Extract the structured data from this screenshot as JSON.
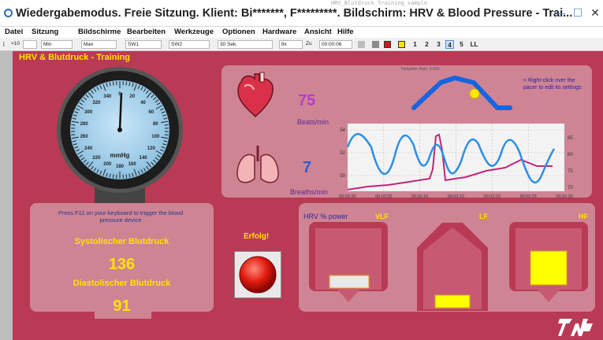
{
  "window": {
    "top_strip": "HRV_Blutdruck_Training_sample",
    "title": "Wiedergabemodus. Freie Sitzung. Klient: Bi*******, F*********. Bildschirm: HRV & Blood Pressure - Trai...",
    "minimize": "—",
    "maximize": "☐",
    "close": "✕"
  },
  "menu": [
    "Datei",
    "Sitzung",
    "Bildschirme",
    "Bearbeiten",
    "Werkzeuge",
    "Optionen",
    "Hardware",
    "Ansicht",
    "Hilfe"
  ],
  "toolbar": {
    "x_label": "×10",
    "min": "Min",
    "max": "Max",
    "sw1": "SW1",
    "sw2": "SW2",
    "interval": "30 Sek.",
    "speed": "8x",
    "zu": "Zu",
    "time": "00:00:06",
    "pages": [
      "1",
      "2",
      "3",
      "4",
      "5"
    ],
    "active_page": "4",
    "lt": "LL"
  },
  "app": {
    "title": "HRV & Blutdruck - Training"
  },
  "gauge": {
    "unit": "mmHg",
    "ticks": [
      "0",
      "20",
      "40",
      "60",
      "80",
      "100",
      "120",
      "140",
      "160",
      "180",
      "200",
      "220",
      "240",
      "260",
      "280",
      "300",
      "320",
      "340"
    ]
  },
  "heart": {
    "value": "75",
    "label": "Beats/min",
    "value_color": "#b63fc7"
  },
  "breath": {
    "value": "7",
    "label": "Breaths/min",
    "value_color": "#2a5fd6"
  },
  "pacer": {
    "caption": "Taktgeber-Rate: 6,000",
    "note": "< Right-click over the pacer to edit its settings"
  },
  "chart_data": {
    "type": "line",
    "x_ticks": [
      "00:02:00",
      "00:02:05",
      "00:02:10",
      "00:02:15",
      "00:02:20",
      "00:02:25",
      "00:02:30"
    ],
    "y_left_ticks": [
      "54",
      "52",
      "50"
    ],
    "y_right_ticks": [
      "85",
      "80",
      "75",
      "70"
    ],
    "series": [
      {
        "color": "#2e8fe0",
        "axis": "right"
      },
      {
        "color": "#c0267a",
        "axis": "left"
      }
    ]
  },
  "bp": {
    "instruction": "Press F11 on your keyboard to trigger the blood pressure device",
    "sys_label": "Systolischer Blutdruck",
    "sys_value": "136",
    "dia_label": "Diastolischer Blutdruck",
    "dia_value": "91",
    "success": "Erfolg!"
  },
  "hrv": {
    "title": "HRV % power",
    "vlf": "VLF",
    "lf": "LF",
    "hf": "HF",
    "vlf_level": 0.2,
    "lf_level": 0.22,
    "hf_level": 0.55
  },
  "colors": {
    "background": "#b93a55",
    "panel": "#cf8494",
    "accent_yellow": "#ffe200"
  }
}
